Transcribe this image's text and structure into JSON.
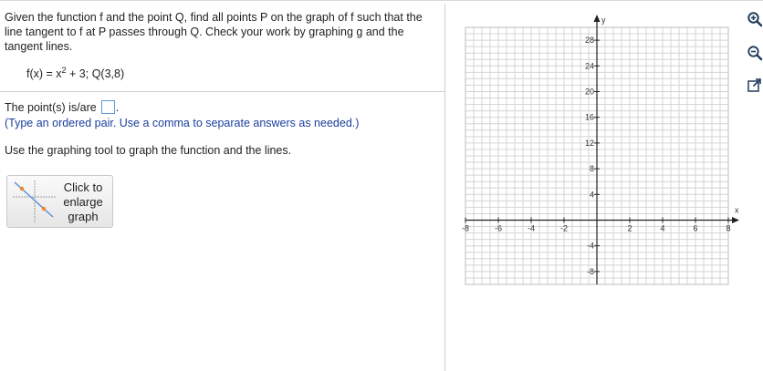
{
  "question": {
    "prompt": "Given the function f and the point Q, find all points P on the graph of f such that the line tangent to f at P passes through Q. Check your work by graphing g and the tangent lines.",
    "formula_pre": "f(x) = x",
    "formula_exp": "2",
    "formula_post": " + 3; Q(3,8)",
    "answer_label": "The point(s) is/are",
    "answer_suffix": ".",
    "answer_value": "",
    "hint": "(Type an ordered pair. Use a comma to separate answers as needed.)",
    "instruction": "Use the graphing tool to graph the function and the lines."
  },
  "enlarge_button": {
    "line1": "Click to",
    "line2": "enlarge",
    "line3": "graph"
  },
  "graph": {
    "x_label": "x",
    "y_label": "y",
    "x_ticks": [
      "-8",
      "-6",
      "-4",
      "-2",
      "2",
      "4",
      "6",
      "8"
    ],
    "y_ticks": [
      "28",
      "24",
      "20",
      "16",
      "12",
      "8",
      "4",
      "-4",
      "-8"
    ],
    "x_range": [
      -8,
      8
    ],
    "y_range": [
      -10,
      30
    ],
    "x_minor_step": 0.5,
    "y_minor_step": 1,
    "grid": true
  },
  "tools": [
    {
      "name": "zoom-in-icon"
    },
    {
      "name": "zoom-out-icon"
    },
    {
      "name": "open-new-window-icon"
    }
  ],
  "colors": {
    "hint": "#1b3f9e",
    "answer_box_border": "#5b9bd5",
    "grid": "#d4d4d4",
    "axis": "#222222"
  }
}
